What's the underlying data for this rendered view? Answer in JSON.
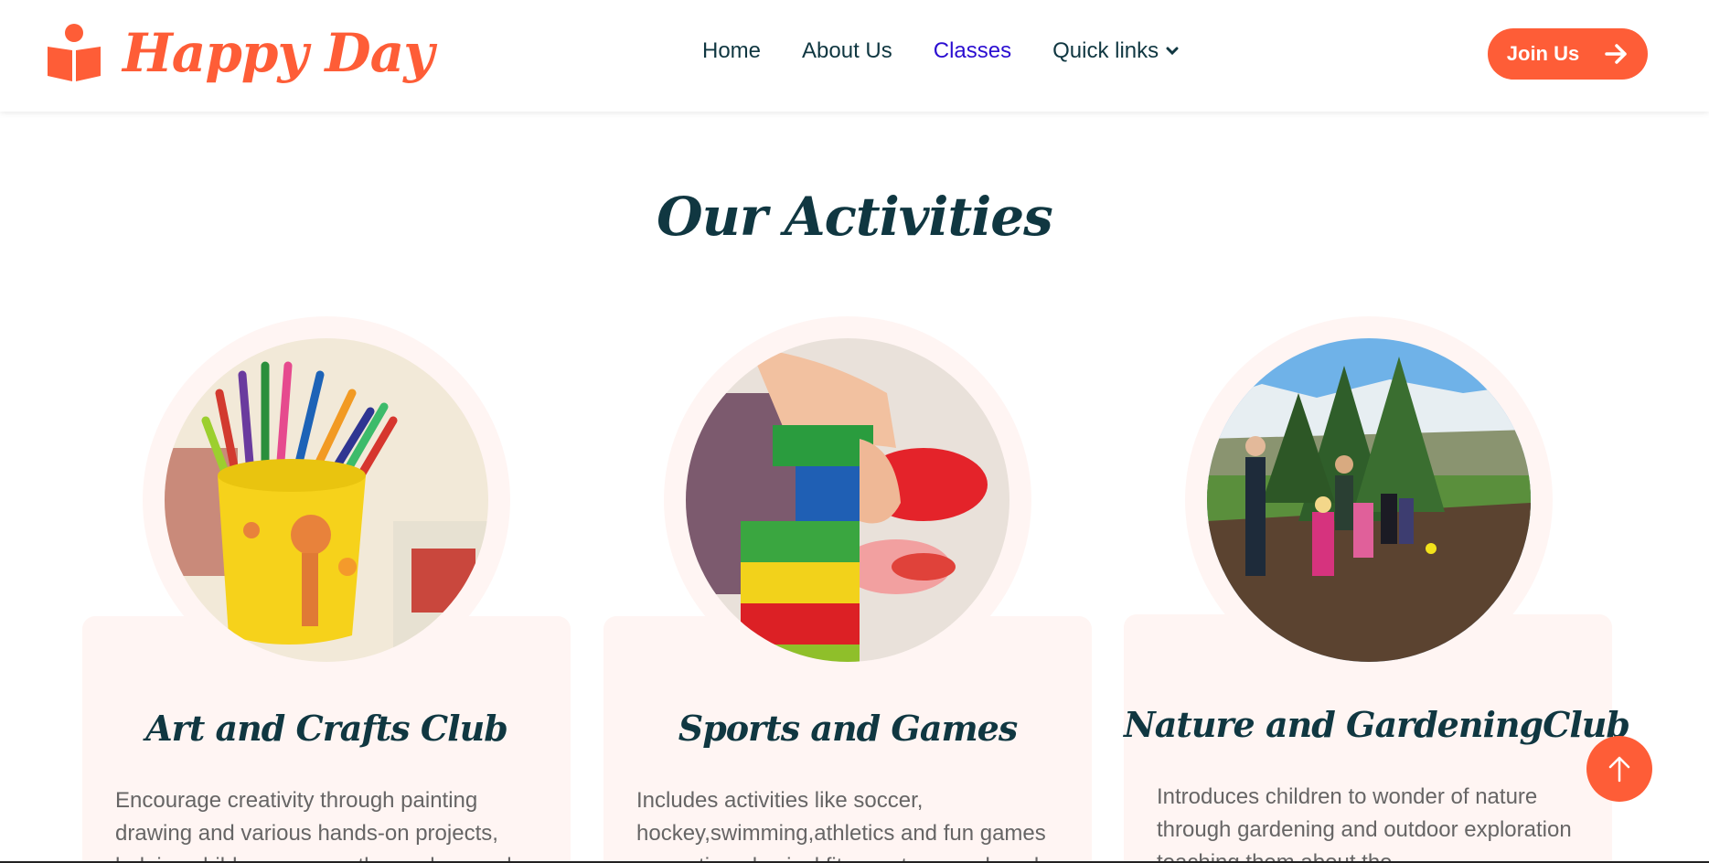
{
  "brand": {
    "name": "Happy Day",
    "accent": "#fe5d37",
    "dark": "#103741",
    "card_bg": "#fff5f3"
  },
  "nav": {
    "items": [
      {
        "label": "Home"
      },
      {
        "label": "About Us"
      },
      {
        "label": "Classes",
        "active": true
      },
      {
        "label": "Quick links",
        "dropdown": true
      }
    ],
    "join_label": "Join Us"
  },
  "section": {
    "title": "Our Activities"
  },
  "activities": [
    {
      "title": "Art and Crafts Club",
      "text": "Encourage creativity through painting drawing and various hands-on projects, helping children express themselves and",
      "image": "pencils-cup-photo"
    },
    {
      "title": "Sports and Games",
      "text": "Includes activities like soccer, hockey,swimming,athletics and fun games promoting physical fitness, teamwork and",
      "image": "building-blocks-photo"
    },
    {
      "title": "Nature and GardeningClub",
      "text": "Introduces children to wonder of nature through gardening and outdoor exploration teaching them about the",
      "image": "children-gardening-photo"
    }
  ],
  "icons": {
    "logo": "book-person-icon",
    "join": "arrow-right-icon",
    "back_to_top": "arrow-up-icon",
    "dropdown": "chevron-down-icon"
  }
}
